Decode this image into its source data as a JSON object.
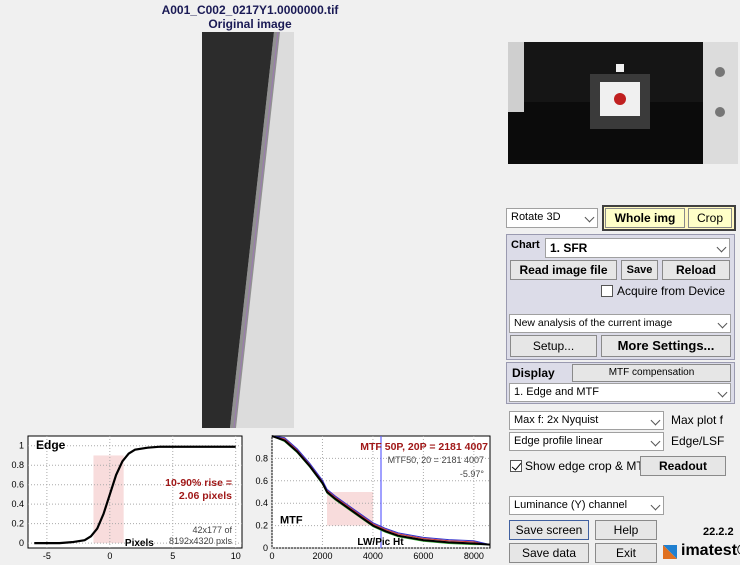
{
  "header": {
    "filename": "A001_C002_0217Y1.0000000.tif",
    "subtitle": "Original image"
  },
  "controls": {
    "rotate": "Rotate 3D",
    "whole_img": "Whole img",
    "crop": "Crop",
    "chart_label": "Chart",
    "chart_value": "1. SFR",
    "read_image_file": "Read image file",
    "save": "Save",
    "reload": "Reload",
    "acquire_from_device": "Acquire from Device",
    "analysis_mode": "New analysis of the current image",
    "setup": "Setup...",
    "more_settings": "More Settings...",
    "display_label": "Display",
    "mtf_compensation": "MTF compensation",
    "display_value": "1. Edge and MTF",
    "max_f": "Max f:   2x Nyquist",
    "max_plot_f": "Max plot f",
    "edge_profile": "Edge profile linear",
    "edge_lsf": "Edge/LSF",
    "show_edge_crop": "Show edge crop & MTF",
    "readout": "Readout",
    "channel": "Luminance (Y) channel",
    "save_screen": "Save screen",
    "help": "Help",
    "version": "22.2.2",
    "save_data": "Save data",
    "exit": "Exit",
    "logo": "imatest®"
  },
  "edge_plot": {
    "title": "Edge",
    "rise_label": "10-90% rise =",
    "rise_value": "2.06 pixels",
    "xlabel": "Pixels",
    "roi": "42x177 of",
    "image_size": "8192x4320 pxls",
    "yticks": [
      "0",
      "0.2",
      "0.4",
      "0.6",
      "0.8",
      "1"
    ],
    "xticks": [
      "-5",
      "0",
      "5",
      "10"
    ]
  },
  "mtf_plot": {
    "summary": "MTF 50P, 20P = 2181  4007",
    "summary2": "MTF50, 20 =  2181  4007",
    "angle": "-5.97°",
    "ylabel": "MTF",
    "xlabel": "LW/Pic Ht",
    "yticks": [
      "0",
      "0.2",
      "0.4",
      "0.6",
      "0.8"
    ],
    "xticks": [
      "0",
      "2000",
      "4000",
      "6000",
      "8000"
    ]
  },
  "chart_data": [
    {
      "type": "line",
      "title": "Edge",
      "xlabel": "Pixels",
      "xlim": [
        -6.5,
        10.5
      ],
      "ylim": [
        -0.05,
        1.1
      ],
      "x": [
        -6,
        -4,
        -3,
        -2,
        -1.5,
        -1,
        -0.5,
        0,
        0.5,
        1,
        1.5,
        2,
        3,
        4,
        6,
        8,
        10
      ],
      "series": [
        {
          "values": [
            0.0,
            0.0,
            0.01,
            0.03,
            0.07,
            0.15,
            0.3,
            0.5,
            0.7,
            0.84,
            0.92,
            0.96,
            0.98,
            0.99,
            0.99,
            0.99,
            0.99
          ]
        }
      ],
      "annotations": [
        "10-90% rise =",
        "2.06 pixels"
      ]
    },
    {
      "type": "line",
      "title": "MTF 50P, 20P = 2181  4007",
      "xlabel": "LW/Pic Ht",
      "ylabel": "MTF",
      "xlim": [
        0,
        8640
      ],
      "ylim": [
        0,
        1.0
      ],
      "x": [
        0,
        500,
        1000,
        1500,
        2000,
        2181,
        2500,
        3000,
        3500,
        4007,
        4500,
        5000,
        6000,
        7000,
        8000,
        8640
      ],
      "series": [
        {
          "values": [
            1.0,
            0.96,
            0.86,
            0.73,
            0.58,
            0.5,
            0.44,
            0.36,
            0.28,
            0.2,
            0.15,
            0.11,
            0.07,
            0.05,
            0.04,
            0.03
          ]
        }
      ],
      "colors": {
        "luminance": "#000000",
        "red": "#cc3333",
        "green": "#33aa33",
        "blue": "#3333cc",
        "nyquist": "#6060ff"
      }
    }
  ]
}
